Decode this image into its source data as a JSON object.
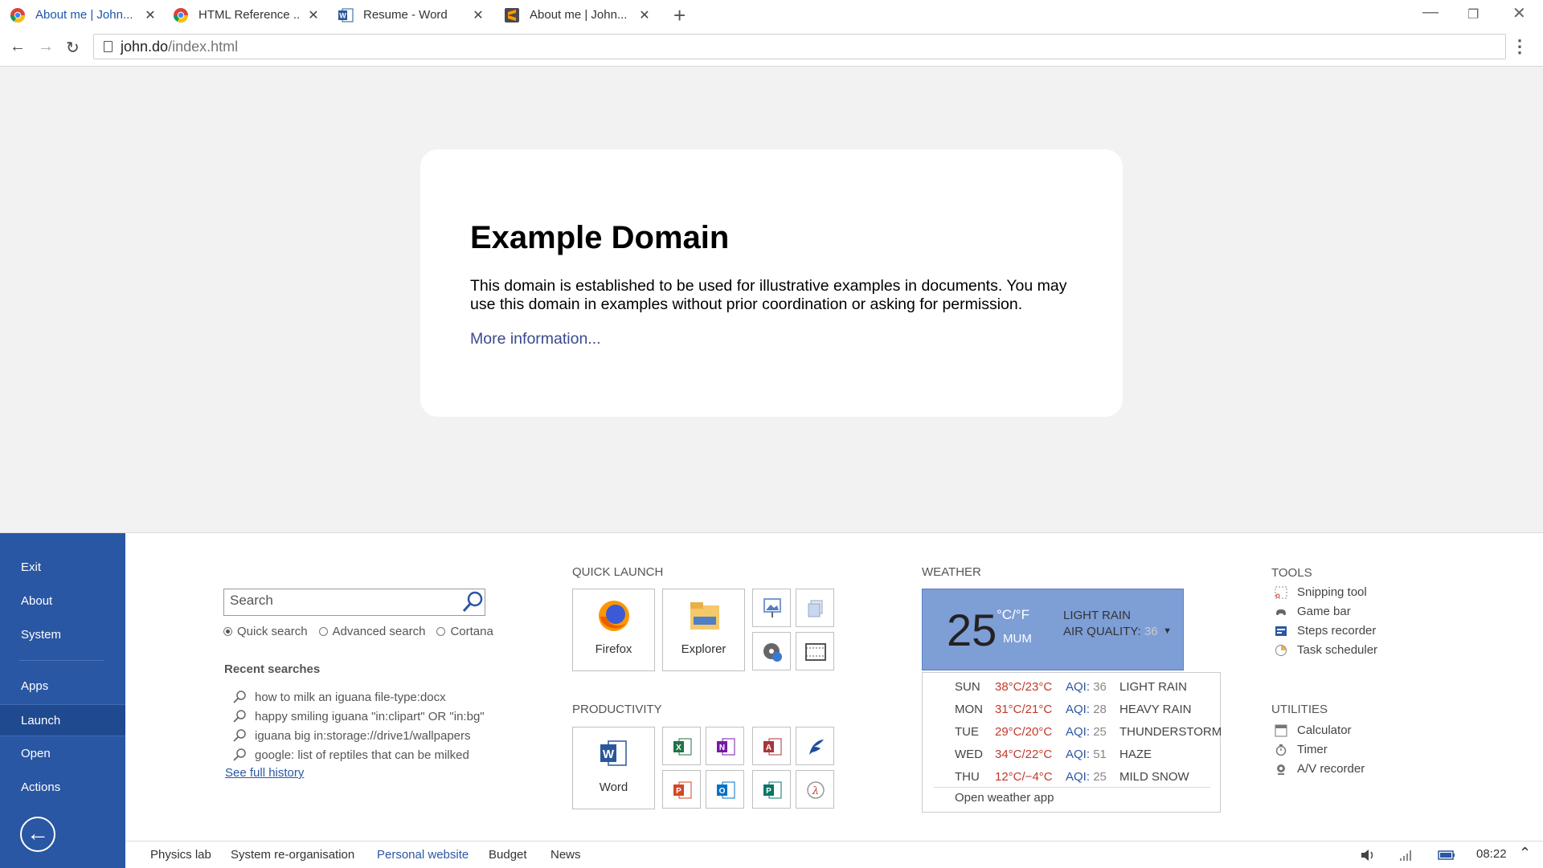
{
  "tabs": [
    {
      "label": "About me | John...",
      "icon": "chrome-icon",
      "active": true
    },
    {
      "label": "HTML Reference ...",
      "icon": "chrome-icon",
      "active": false
    },
    {
      "label": "Resume - Word",
      "icon": "word-icon",
      "active": false
    },
    {
      "label": "About me | John...",
      "icon": "sublime-icon",
      "active": false
    }
  ],
  "address": {
    "host": "john.do",
    "path": "/index.html"
  },
  "page": {
    "title": "Example Domain",
    "body": "This domain is established to be used for illustrative examples in documents. You may use this domain in examples without prior coordination or asking for permission.",
    "link": "More information..."
  },
  "sidebar": {
    "items": [
      {
        "label": "Exit"
      },
      {
        "label": "About"
      },
      {
        "label": "System"
      },
      {
        "label": "Apps"
      },
      {
        "label": "Launch"
      },
      {
        "label": "Open"
      },
      {
        "label": "Actions"
      }
    ],
    "active": "Launch"
  },
  "search": {
    "placeholder": "Search",
    "options": [
      "Quick search",
      "Advanced search",
      "Cortana"
    ],
    "selected": "Quick search",
    "recent_heading": "Recent searches",
    "recent": [
      "how to milk an iguana file-type:docx",
      "happy smiling iguana \"in:clipart\" OR \"in:bg\"",
      "iguana big in:storage://drive1/wallpapers",
      "google: list of reptiles that can be milked"
    ],
    "history_link": "See full history"
  },
  "quick_launch": {
    "heading": "QUICK LAUNCH",
    "tiles": [
      {
        "label": "Firefox",
        "icon": "firefox-icon"
      },
      {
        "label": "Explorer",
        "icon": "folder-icon"
      }
    ],
    "small_icons": [
      "image-viewer-icon",
      "files-icon",
      "media-player-icon",
      "film-icon"
    ]
  },
  "productivity": {
    "heading": "PRODUCTIVITY",
    "tiles": [
      {
        "label": "Word",
        "icon": "word-icon"
      }
    ],
    "small_icons": [
      "excel-icon",
      "onenote-icon",
      "access-icon",
      "feather-icon",
      "powerpoint-icon",
      "outlook-icon",
      "publisher-icon",
      "lambda-icon"
    ]
  },
  "weather": {
    "heading": "WEATHER",
    "temp": "25",
    "unit": "°C/°F",
    "city": "MUM",
    "condition": "LIGHT RAIN",
    "aq_label": "AIR QUALITY:",
    "aq_value": "36",
    "forecast": [
      {
        "day": "SUN",
        "temp": "38°C/23°C",
        "aqi_label": "AQI:",
        "aqi": "36",
        "cond": "LIGHT RAIN"
      },
      {
        "day": "MON",
        "temp": "31°C/21°C",
        "aqi_label": "AQI:",
        "aqi": "28",
        "cond": "HEAVY RAIN"
      },
      {
        "day": "TUE",
        "temp": "29°C/20°C",
        "aqi_label": "AQI:",
        "aqi": "25",
        "cond": "THUNDERSTORM"
      },
      {
        "day": "WED",
        "temp": "34°C/22°C",
        "aqi_label": "AQI:",
        "aqi": "51",
        "cond": "HAZE"
      },
      {
        "day": "THU",
        "temp": "12°C/−4°C",
        "aqi_label": "AQI:",
        "aqi": "25",
        "cond": "MILD SNOW"
      }
    ],
    "open_app": "Open weather app"
  },
  "tools": {
    "heading": "TOOLS",
    "items": [
      "Snipping tool",
      "Game bar",
      "Steps recorder",
      "Task scheduler"
    ]
  },
  "utilities": {
    "heading": "UTILITIES",
    "items": [
      "Calculator",
      "Timer",
      "A/V recorder"
    ]
  },
  "bottom": {
    "items": [
      "Physics lab",
      "System re-organisation",
      "Personal website",
      "Budget",
      "News"
    ],
    "active": "Personal website",
    "clock": "08:22"
  },
  "colors": {
    "accent": "#2a57a3",
    "weather_bg": "#7e9ed6"
  }
}
